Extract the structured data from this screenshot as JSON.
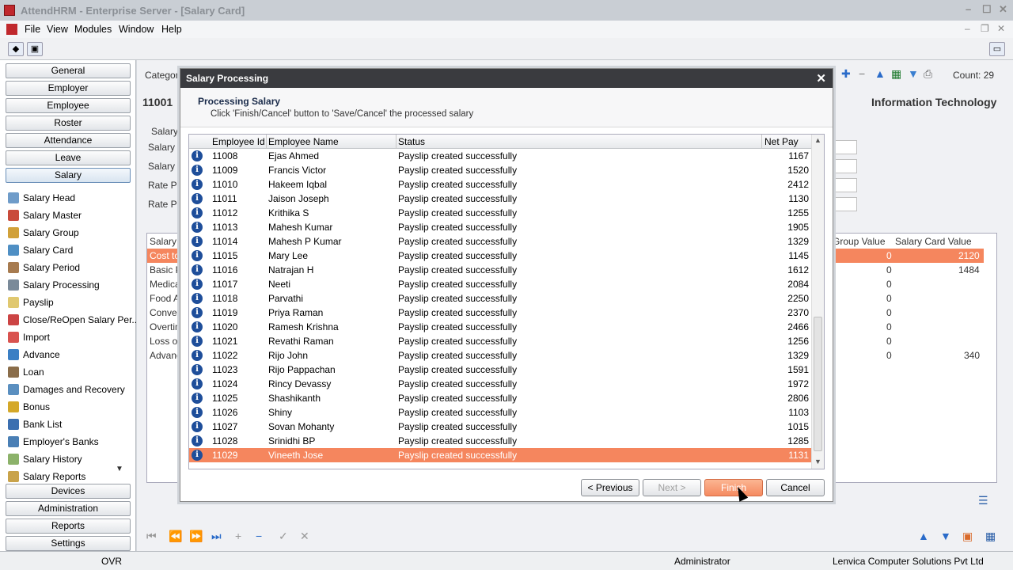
{
  "window": {
    "title": "AttendHRM - Enterprise Server - [Salary Card]"
  },
  "menu": [
    "File",
    "View",
    "Modules",
    "Window",
    "Help"
  ],
  "left_nav": {
    "top_buttons": [
      "General",
      "Employer",
      "Employee",
      "Roster",
      "Attendance",
      "Leave",
      "Salary"
    ],
    "salary_items": [
      "Salary Head",
      "Salary Master",
      "Salary Group",
      "Salary Card",
      "Salary Period",
      "Salary Processing",
      "Payslip",
      "Close/ReOpen Salary Per...",
      "Import",
      "Advance",
      "Loan",
      "Damages and Recovery",
      "Bonus",
      "Bank List",
      "Employer's Banks",
      "Salary History",
      "Salary Reports"
    ],
    "bottom_buttons": [
      "Devices",
      "Administration",
      "Reports",
      "Settings"
    ]
  },
  "background": {
    "category_label": "Category",
    "count": "Count: 29",
    "employee_id": "11001",
    "department": "Information Technology",
    "salary_group_title": "Salary",
    "field_labels": [
      "Salary C",
      "Salary G",
      "Rate Pe",
      "Rate Pe"
    ],
    "grid_headers": [
      "Salary H",
      "Group Value",
      "Salary Card Value"
    ],
    "grid_rows": [
      {
        "name": "Cost to",
        "group": "0",
        "card": "2120"
      },
      {
        "name": "Basic P",
        "group": "0",
        "card": "1484"
      },
      {
        "name": "Medical",
        "group": "0",
        "card": ""
      },
      {
        "name": "Food All",
        "group": "0",
        "card": ""
      },
      {
        "name": "Convey",
        "group": "0",
        "card": ""
      },
      {
        "name": "Overtim",
        "group": "0",
        "card": ""
      },
      {
        "name": "Loss of",
        "group": "0",
        "card": ""
      },
      {
        "name": "Advanc",
        "group": "0",
        "card": "340"
      }
    ]
  },
  "dialog": {
    "title": "Salary Processing",
    "heading": "Processing Salary",
    "subheading": "Click 'Finish/Cancel' button to 'Save/Cancel' the processed salary",
    "columns": [
      "Employee Id",
      "Employee Name",
      "Status",
      "Net Pay"
    ],
    "rows": [
      {
        "id": "11008",
        "name": "Ejas Ahmed",
        "status": "Payslip created successfully",
        "pay": "1167"
      },
      {
        "id": "11009",
        "name": "Francis Victor",
        "status": "Payslip created successfully",
        "pay": "1520"
      },
      {
        "id": "11010",
        "name": "Hakeem Iqbal",
        "status": "Payslip created successfully",
        "pay": "2412"
      },
      {
        "id": "11011",
        "name": "Jaison Joseph",
        "status": "Payslip created successfully",
        "pay": "1130"
      },
      {
        "id": "11012",
        "name": "Krithika S",
        "status": "Payslip created successfully",
        "pay": "1255"
      },
      {
        "id": "11013",
        "name": "Mahesh Kumar",
        "status": "Payslip created successfully",
        "pay": "1905"
      },
      {
        "id": "11014",
        "name": "Mahesh P Kumar",
        "status": "Payslip created successfully",
        "pay": "1329"
      },
      {
        "id": "11015",
        "name": "Mary Lee",
        "status": "Payslip created successfully",
        "pay": "1145"
      },
      {
        "id": "11016",
        "name": "Natrajan H",
        "status": "Payslip created successfully",
        "pay": "1612"
      },
      {
        "id": "11017",
        "name": "Neeti",
        "status": "Payslip created successfully",
        "pay": "2084"
      },
      {
        "id": "11018",
        "name": "Parvathi",
        "status": "Payslip created successfully",
        "pay": "2250"
      },
      {
        "id": "11019",
        "name": "Priya Raman",
        "status": "Payslip created successfully",
        "pay": "2370"
      },
      {
        "id": "11020",
        "name": "Ramesh Krishna",
        "status": "Payslip created successfully",
        "pay": "2466"
      },
      {
        "id": "11021",
        "name": "Revathi Raman",
        "status": "Payslip created successfully",
        "pay": "1256"
      },
      {
        "id": "11022",
        "name": "Rijo John",
        "status": "Payslip created successfully",
        "pay": "1329"
      },
      {
        "id": "11023",
        "name": "Rijo Pappachan",
        "status": "Payslip created successfully",
        "pay": "1591"
      },
      {
        "id": "11024",
        "name": "Rincy Devassy",
        "status": "Payslip created successfully",
        "pay": "1972"
      },
      {
        "id": "11025",
        "name": "Shashikanth",
        "status": "Payslip created successfully",
        "pay": "2806"
      },
      {
        "id": "11026",
        "name": "Shiny",
        "status": "Payslip created successfully",
        "pay": "1103"
      },
      {
        "id": "11027",
        "name": "Sovan Mohanty",
        "status": "Payslip created successfully",
        "pay": "1015"
      },
      {
        "id": "11028",
        "name": "Srinidhi BP",
        "status": "Payslip created successfully",
        "pay": "1285"
      },
      {
        "id": "11029",
        "name": "Vineeth Jose",
        "status": "Payslip created successfully",
        "pay": "1131"
      }
    ],
    "selected_row": "11029",
    "buttons": {
      "previous": "< Previous",
      "next": "Next >",
      "finish": "Finish",
      "cancel": "Cancel"
    }
  },
  "statusbar": {
    "mode": "OVR",
    "user": "Administrator",
    "company": "Lenvica Computer Solutions Pvt Ltd"
  },
  "colors": {
    "selection": "#f5865e",
    "dialog_title": "#3a3b3f",
    "info_icon": "#1e4e9a"
  }
}
